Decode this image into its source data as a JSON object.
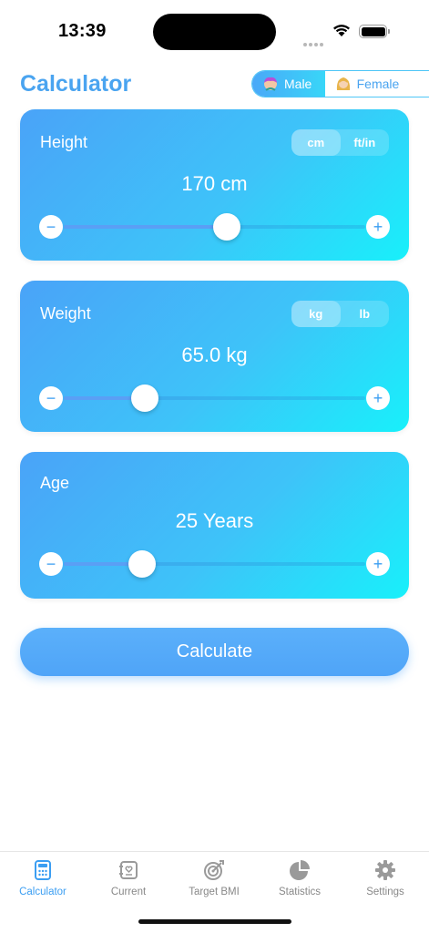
{
  "status_bar": {
    "time": "13:39"
  },
  "header": {
    "title": "Calculator",
    "gender": {
      "male": "Male",
      "female": "Female",
      "selected": "male"
    }
  },
  "height_card": {
    "label": "Height",
    "units": [
      "cm",
      "ft/in"
    ],
    "selected_unit": "cm",
    "value": "170 cm",
    "slider_fraction": 0.54,
    "minus": "−",
    "plus": "+"
  },
  "weight_card": {
    "label": "Weight",
    "units": [
      "kg",
      "lb"
    ],
    "selected_unit": "kg",
    "value": "65.0 kg",
    "slider_fraction": 0.27,
    "minus": "−",
    "plus": "+"
  },
  "age_card": {
    "label": "Age",
    "value": "25 Years",
    "slider_fraction": 0.26,
    "minus": "−",
    "plus": "+"
  },
  "calculate_label": "Calculate",
  "tab_bar": {
    "tabs": [
      {
        "label": "Calculator",
        "icon": "calculator-icon",
        "active": true
      },
      {
        "label": "Current",
        "icon": "current-icon",
        "active": false
      },
      {
        "label": "Target BMI",
        "icon": "target-icon",
        "active": false
      },
      {
        "label": "Statistics",
        "icon": "pie-chart-icon",
        "active": false
      },
      {
        "label": "Settings",
        "icon": "gear-icon",
        "active": false
      }
    ]
  },
  "colors": {
    "accent": "#4aa4f0",
    "card_start": "#4aa3f8",
    "card_end": "#18f0fa",
    "inactive": "#888888"
  }
}
